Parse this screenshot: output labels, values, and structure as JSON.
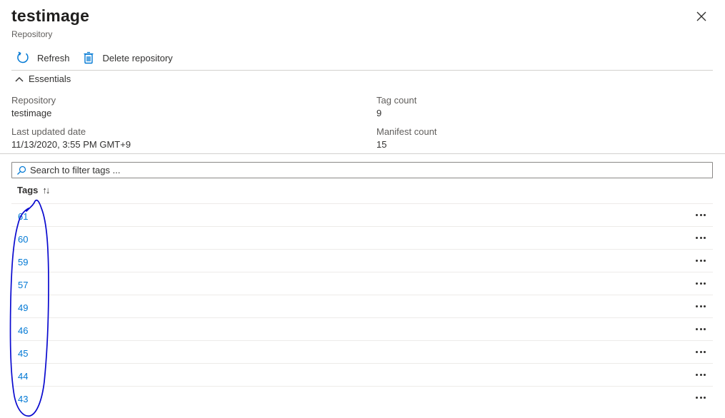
{
  "header": {
    "title": "testimage",
    "subtitle": "Repository",
    "close_icon": "close-icon"
  },
  "toolbar": {
    "refresh_label": "Refresh",
    "refresh_icon": "refresh-icon",
    "delete_label": "Delete repository",
    "delete_icon": "trash-icon"
  },
  "essentials": {
    "toggle_label": "Essentials",
    "toggle_icon": "chevron-up-icon",
    "fields": [
      {
        "label": "Repository",
        "value": "testimage"
      },
      {
        "label": "Tag count",
        "value": "9"
      },
      {
        "label": "Last updated date",
        "value": "11/13/2020, 3:55 PM GMT+9"
      },
      {
        "label": "Manifest count",
        "value": "15"
      }
    ]
  },
  "search": {
    "placeholder": "Search to filter tags ...",
    "value": "",
    "icon": "search-icon"
  },
  "table": {
    "column_header": "Tags",
    "sort_glyph": "↑↓",
    "rows": [
      "61",
      "60",
      "59",
      "57",
      "49",
      "46",
      "45",
      "44",
      "43"
    ],
    "more_icon": "more-options-icon"
  },
  "colors": {
    "link": "#0078d4",
    "text": "#323130",
    "muted": "#605e5c",
    "divider": "#d2d0ce",
    "annotation": "#0a0acf"
  }
}
